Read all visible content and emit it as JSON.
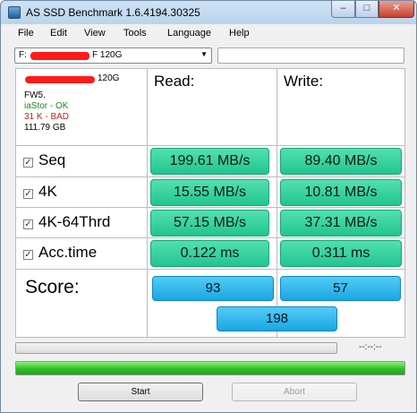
{
  "window": {
    "title": "AS SSD Benchmark 1.6.4194.30325",
    "minimize": "–",
    "maximize": "□",
    "close": "✕"
  },
  "menu": [
    "File",
    "Edit",
    "View",
    "Tools",
    "Language",
    "Help"
  ],
  "drive_select": {
    "prefix": "F:",
    "suffix": "F 120G",
    "arrow": "▼"
  },
  "drive_info": {
    "capacity_suffix": "120G",
    "firmware": "FW5.",
    "driver": "iaStor - OK",
    "alignment": "31 K - BAD",
    "size": "111.79 GB"
  },
  "headers": {
    "read": "Read:",
    "write": "Write:"
  },
  "tests": [
    {
      "name": "Seq",
      "checked": true,
      "read": "199.61 MB/s",
      "write": "89.40 MB/s"
    },
    {
      "name": "4K",
      "checked": true,
      "read": "15.55 MB/s",
      "write": "10.81 MB/s"
    },
    {
      "name": "4K-64Thrd",
      "checked": true,
      "read": "57.15 MB/s",
      "write": "37.31 MB/s"
    },
    {
      "name": "Acc.time",
      "checked": true,
      "read": "0.122 ms",
      "write": "0.311 ms"
    }
  ],
  "checkmark": "✓",
  "score": {
    "label": "Score:",
    "read": "93",
    "write": "57",
    "total": "198"
  },
  "elapsed_time": "--:--:--",
  "progress_fraction": 1.0,
  "buttons": {
    "start": "Start",
    "abort": "Abort"
  },
  "colors": {
    "result_green": "#22c58f",
    "score_blue": "#1aa6e2",
    "progress_green": "#2fbf26",
    "ok_text": "#1a8a1a",
    "bad_text": "#c0241b"
  }
}
